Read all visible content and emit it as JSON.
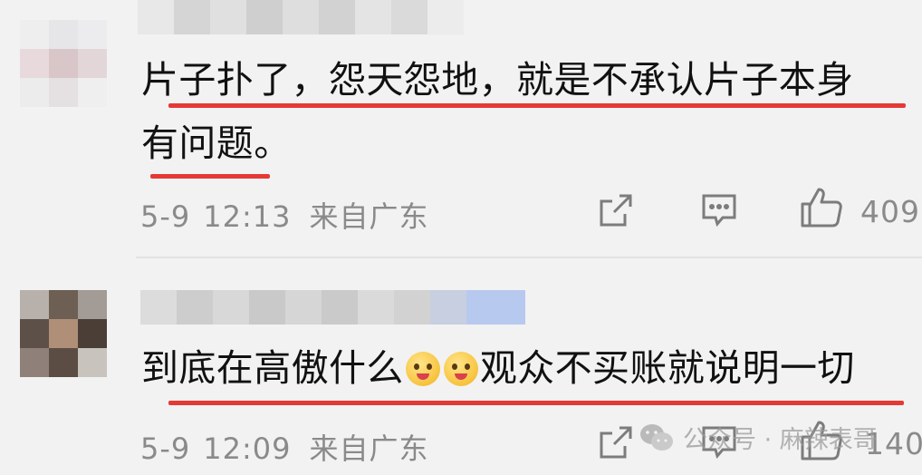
{
  "comments": [
    {
      "username": "",
      "lines": [
        "片子扑了，怨天怨地，就是不承认片子本身",
        "有问题。"
      ],
      "date": "5-9",
      "time": "12:13",
      "location": "来自广东",
      "like_count": "409"
    },
    {
      "username": "",
      "text_before": "到底在高傲什么",
      "emojis": [
        "drooling-face",
        "drooling-face"
      ],
      "text_after": "观众不买账就说明一切",
      "date": "5-9",
      "time": "12:09",
      "location": "来自广东",
      "like_count": "140"
    }
  ],
  "watermark": {
    "text": "公众号 · 麻辣表哥",
    "icon": "wechat-icon"
  },
  "colors": {
    "background": "#f2f2f2",
    "underline": "#e53935",
    "meta": "#8a8a8a",
    "text": "#111111"
  }
}
